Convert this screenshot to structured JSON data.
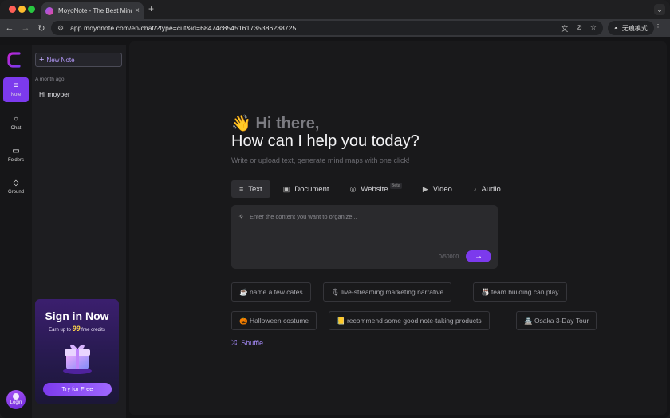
{
  "browser": {
    "tab_title": "MoyoNote - The Best Mind M",
    "tab_close": "×",
    "new_tab": "+",
    "url": "app.moyonote.com/en/chat/?type=cut&id=68474c8545161735386238725",
    "incognito_label": "无痕模式",
    "nav": {
      "back": "←",
      "forward": "→",
      "reload": "↻"
    },
    "menu": "⋮",
    "tab_menu": "⌄"
  },
  "rail": {
    "items": [
      {
        "label": "Note",
        "icon": "note-icon",
        "glyph": "≡",
        "active": true
      },
      {
        "label": "Chat",
        "icon": "chat-icon",
        "glyph": "○",
        "active": false
      },
      {
        "label": "Folders",
        "icon": "folder-icon",
        "glyph": "▭",
        "active": false
      },
      {
        "label": "Ground",
        "icon": "ground-icon",
        "glyph": "◇",
        "active": false
      }
    ],
    "login_label": "Login"
  },
  "notes": {
    "new_note_label": "New Note",
    "group_label": "A month ago",
    "items": [
      "Hi moyoer"
    ],
    "promo": {
      "title": "Sign in Now",
      "sub_prefix": "Earn up to",
      "sub_number": "99",
      "sub_suffix": "free credits",
      "button": "Try for Free"
    }
  },
  "main": {
    "greeting_emoji": "👋",
    "greeting": "Hi there,",
    "headline": "How can I help you today?",
    "subline": "Write or upload text, generate mind maps with one click!",
    "modes": [
      {
        "label": "Text",
        "icon": "text-icon",
        "glyph": "≡",
        "active": true
      },
      {
        "label": "Document",
        "icon": "document-icon",
        "glyph": "▣",
        "active": false
      },
      {
        "label": "Website",
        "icon": "globe-icon",
        "glyph": "◎",
        "active": false,
        "badge": "Beta"
      },
      {
        "label": "Video",
        "icon": "video-icon",
        "glyph": "▶",
        "active": false
      },
      {
        "label": "Audio",
        "icon": "audio-icon",
        "glyph": "♪",
        "active": false
      }
    ],
    "input": {
      "placeholder": "Enter the content you want to organize...",
      "counter": "0/50000"
    },
    "suggestions": [
      "☕ name a few cafes",
      "🎙 live-streaming marketing narrative",
      "🎳 team building can play",
      "🎃 Halloween costume",
      "📒 recommend some good note-taking products",
      "🏯 Osaka 3-Day Tour"
    ],
    "shuffle_label": "Shuffle"
  },
  "colors": {
    "accent": "#7c3aed",
    "background": "#19191b",
    "sidebar": "#1d1d20"
  }
}
